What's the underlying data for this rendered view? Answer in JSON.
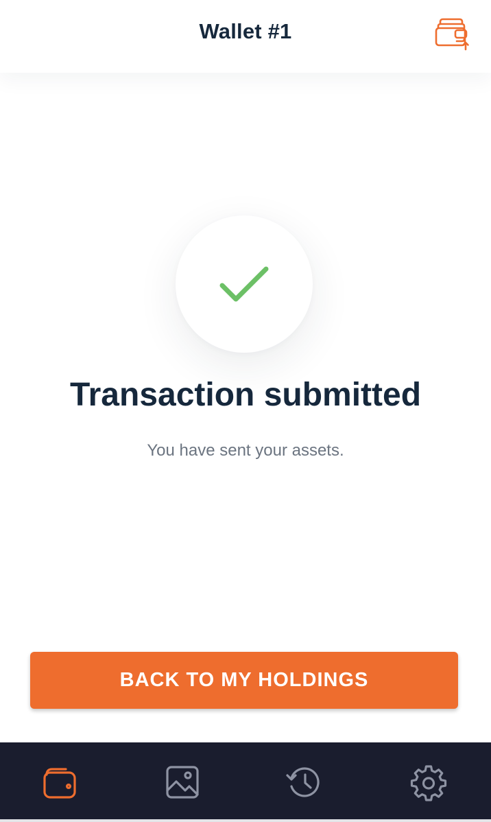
{
  "header": {
    "title": "Wallet #1",
    "action_icon": "wallet-switch-icon"
  },
  "result": {
    "icon": "checkmark-icon",
    "title": "Transaction submitted",
    "subtitle": "You have sent your assets."
  },
  "actions": {
    "primary_label": "BACK TO MY HOLDINGS"
  },
  "bottom_nav": {
    "items": [
      {
        "id": "wallet",
        "icon": "wallet-icon",
        "active": true
      },
      {
        "id": "gallery",
        "icon": "image-icon",
        "active": false
      },
      {
        "id": "history",
        "icon": "history-icon",
        "active": false
      },
      {
        "id": "settings",
        "icon": "gear-icon",
        "active": false
      }
    ]
  },
  "colors": {
    "accent": "#ee6d2e",
    "success": "#6cc066",
    "title_text": "#16283c",
    "muted_text": "#6b7480",
    "nav_background": "#1a1d2e",
    "nav_icon_inactive": "#8e93a3"
  }
}
